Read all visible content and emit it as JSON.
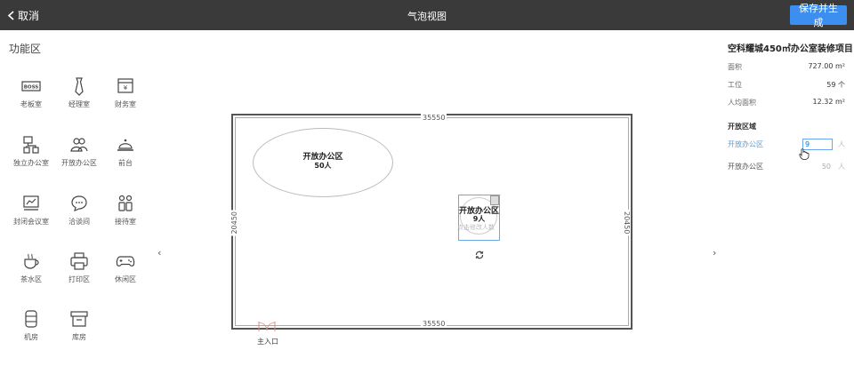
{
  "topbar": {
    "cancel_label": "取消",
    "title": "气泡视图",
    "save_label": "保存并生成"
  },
  "function_panel": {
    "title": "功能区",
    "items": [
      {
        "label": "老板室",
        "icon": "boss-icon"
      },
      {
        "label": "经理室",
        "icon": "tie-icon"
      },
      {
        "label": "财务室",
        "icon": "safe-icon"
      },
      {
        "label": "独立办公室",
        "icon": "org-chart-icon"
      },
      {
        "label": "开放办公区",
        "icon": "group-icon"
      },
      {
        "label": "前台",
        "icon": "reception-bell-icon"
      },
      {
        "label": "封闭会议室",
        "icon": "presentation-icon"
      },
      {
        "label": "洽谈间",
        "icon": "chat-icon"
      },
      {
        "label": "接待室",
        "icon": "people-icon"
      },
      {
        "label": "茶水区",
        "icon": "coffee-cup-icon"
      },
      {
        "label": "打印区",
        "icon": "printer-icon"
      },
      {
        "label": "休闲区",
        "icon": "gamepad-icon"
      },
      {
        "label": "机房",
        "icon": "server-icon"
      },
      {
        "label": "库房",
        "icon": "archive-box-icon"
      }
    ]
  },
  "canvas": {
    "dim_top": "35550",
    "dim_bottom": "35550",
    "dim_left": "20450",
    "dim_right": "20450",
    "zone1": {
      "name": "开放办公区",
      "count": "50人"
    },
    "zone2": {
      "name": "开放办公区",
      "count": "9人",
      "hint": "点击修改人数"
    },
    "entrance_label": "主入口"
  },
  "project": {
    "title": "空科耀城450㎡办公室装修项目",
    "stats": [
      {
        "label": "面积",
        "value": "727.00 m²"
      },
      {
        "label": "工位",
        "value": "59 个"
      },
      {
        "label": "人均面积",
        "value": "12.32 m²"
      }
    ],
    "open_area_label": "开放区域",
    "zones": [
      {
        "label": "开放办公区",
        "value": "9",
        "unit": "人"
      },
      {
        "label": "开放办公区",
        "value": "50",
        "unit": "人"
      }
    ]
  },
  "colors": {
    "topbar": "#3a3a3a",
    "accent": "#3c8ff0",
    "active_zone_text": "#5b9bd5"
  }
}
